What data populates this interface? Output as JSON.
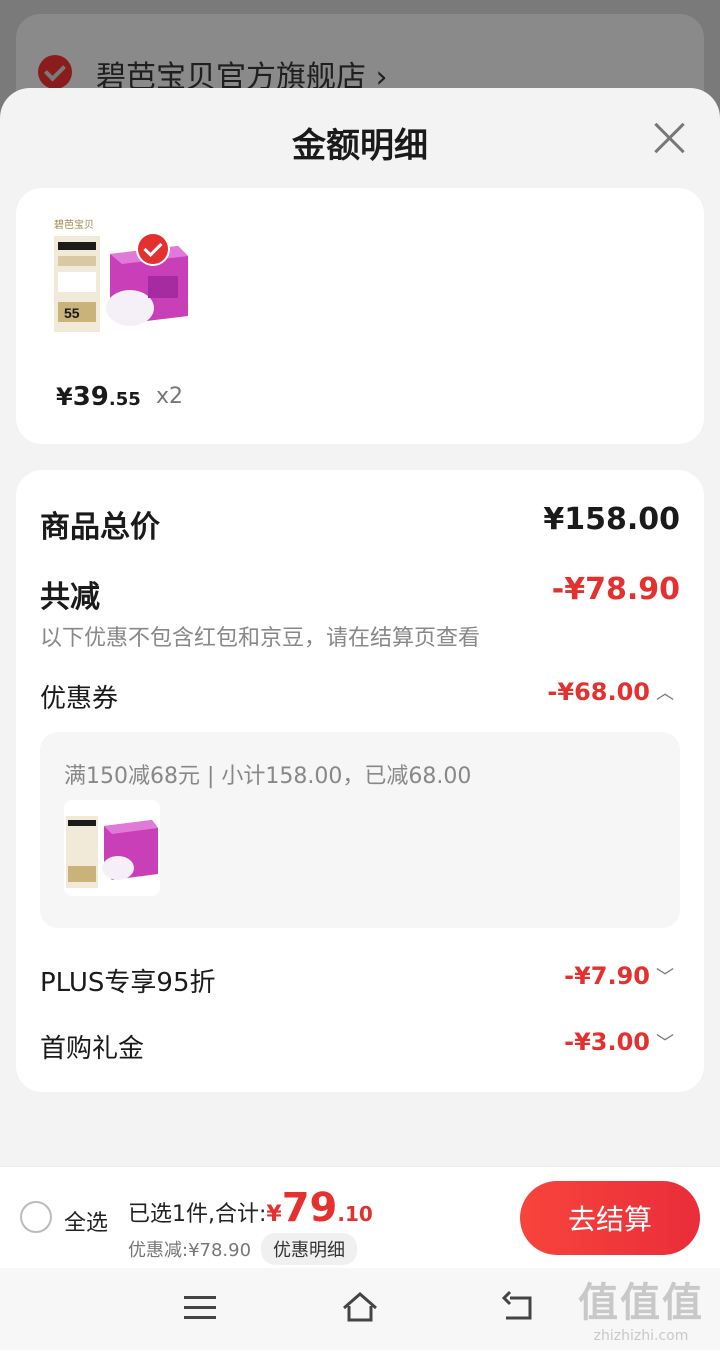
{
  "store": {
    "name": "碧芭宝贝官方旗舰店 ›"
  },
  "sheet": {
    "title": "金额明细"
  },
  "product": {
    "price_currency": "¥",
    "price_int": "39",
    "price_dec": ".55",
    "quantity": "x2",
    "image_brand": "碧芭宝贝",
    "image_price": "55"
  },
  "detail": {
    "total_label": "商品总价",
    "total_value": "¥158.00",
    "reduce_label": "共减",
    "reduce_value": "-¥78.90",
    "note": "以下优惠不包含红包和京豆，请在结算页查看",
    "coupon_label": "优惠券",
    "coupon_value": "-¥68.00",
    "coupon_desc": "满150减68元 | 小计158.00，已减68.00",
    "plus_label": "PLUS专享95折",
    "plus_value": "-¥7.90",
    "first_label": "首购礼金",
    "first_value": "-¥3.00"
  },
  "bottom": {
    "select_all": "全选",
    "summary_label": "已选1件,合计:",
    "sum_currency": "¥",
    "sum_int": "79",
    "sum_dec": ".10",
    "discount_text": "优惠减:¥78.90",
    "detail_chip": "优惠明细",
    "checkout": "去结算"
  },
  "watermark": {
    "big": "值值值",
    "small": "zhizhizhi.com"
  },
  "colors": {
    "accent": "#e4312f",
    "background": "#f3f3f3"
  }
}
